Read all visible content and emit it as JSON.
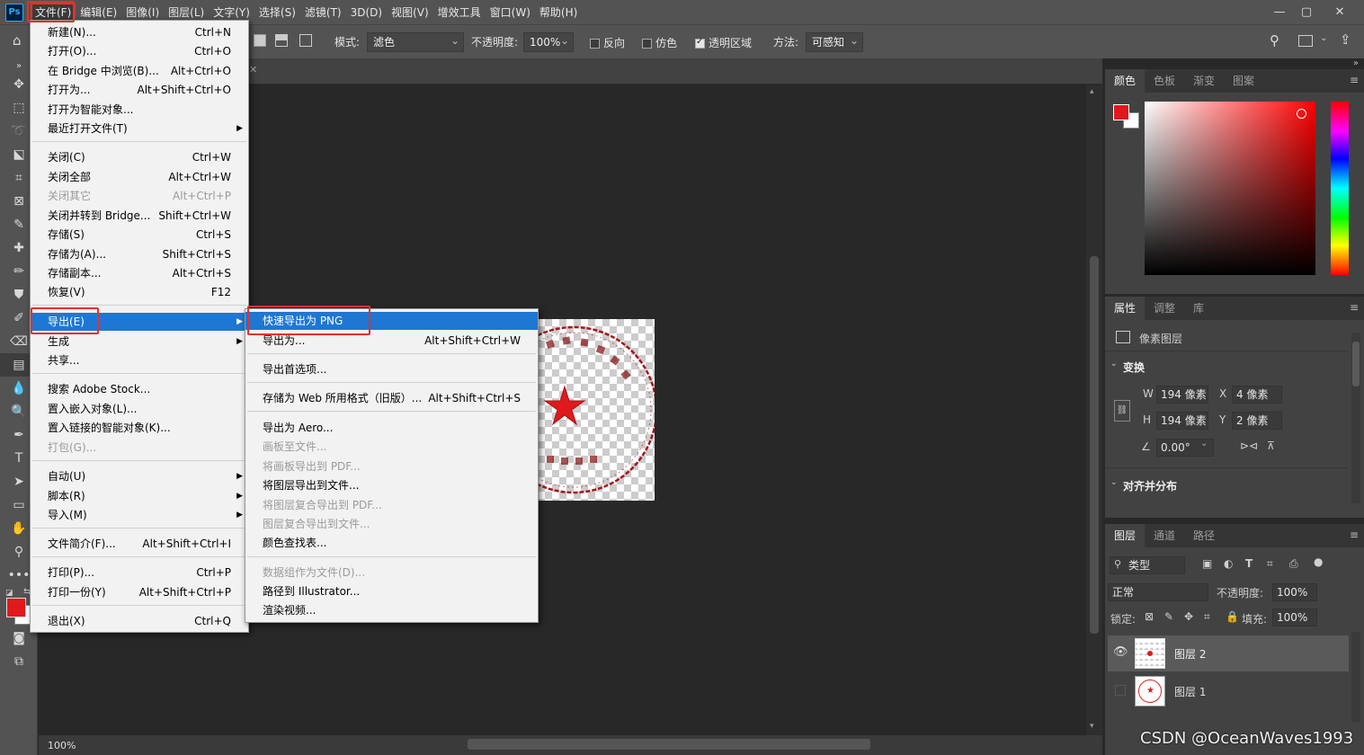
{
  "app": {
    "logo": "Ps"
  },
  "menubar": {
    "items": [
      "文件(F)",
      "编辑(E)",
      "图像(I)",
      "图层(L)",
      "文字(Y)",
      "选择(S)",
      "滤镜(T)",
      "3D(D)",
      "视图(V)",
      "增效工具",
      "窗口(W)",
      "帮助(H)"
    ]
  },
  "options": {
    "mode_label": "模式:",
    "mode_value": "滤色",
    "opacity_label": "不透明度:",
    "opacity_value": "100%",
    "reverse_label": "反向",
    "dither_label": "仿色",
    "transparency_label": "透明区域",
    "method_label": "方法:",
    "method_value": "可感知"
  },
  "file_menu": {
    "items": [
      {
        "label": "新建(N)...",
        "shortcut": "Ctrl+N"
      },
      {
        "label": "打开(O)...",
        "shortcut": "Ctrl+O"
      },
      {
        "label": "在 Bridge 中浏览(B)...",
        "shortcut": "Alt+Ctrl+O"
      },
      {
        "label": "打开为...",
        "shortcut": "Alt+Shift+Ctrl+O"
      },
      {
        "label": "打开为智能对象...",
        "shortcut": ""
      },
      {
        "label": "最近打开文件(T)",
        "shortcut": ""
      },
      {
        "label": "关闭(C)",
        "shortcut": "Ctrl+W"
      },
      {
        "label": "关闭全部",
        "shortcut": "Alt+Ctrl+W"
      },
      {
        "label": "关闭其它",
        "shortcut": "Alt+Ctrl+P"
      },
      {
        "label": "关闭并转到 Bridge...",
        "shortcut": "Shift+Ctrl+W"
      },
      {
        "label": "存储(S)",
        "shortcut": "Ctrl+S"
      },
      {
        "label": "存储为(A)...",
        "shortcut": "Shift+Ctrl+S"
      },
      {
        "label": "存储副本...",
        "shortcut": "Alt+Ctrl+S"
      },
      {
        "label": "恢复(V)",
        "shortcut": "F12"
      },
      {
        "label": "导出(E)",
        "shortcut": ""
      },
      {
        "label": "生成",
        "shortcut": ""
      },
      {
        "label": "共享...",
        "shortcut": ""
      },
      {
        "label": "搜索 Adobe Stock...",
        "shortcut": ""
      },
      {
        "label": "置入嵌入对象(L)...",
        "shortcut": ""
      },
      {
        "label": "置入链接的智能对象(K)...",
        "shortcut": ""
      },
      {
        "label": "打包(G)...",
        "shortcut": ""
      },
      {
        "label": "自动(U)",
        "shortcut": ""
      },
      {
        "label": "脚本(R)",
        "shortcut": ""
      },
      {
        "label": "导入(M)",
        "shortcut": ""
      },
      {
        "label": "文件简介(F)...",
        "shortcut": "Alt+Shift+Ctrl+I"
      },
      {
        "label": "打印(P)...",
        "shortcut": "Ctrl+P"
      },
      {
        "label": "打印一份(Y)",
        "shortcut": "Alt+Shift+Ctrl+P"
      },
      {
        "label": "退出(X)",
        "shortcut": "Ctrl+Q"
      }
    ]
  },
  "export_menu": {
    "items": [
      {
        "label": "快速导出为 PNG",
        "shortcut": ""
      },
      {
        "label": "导出为...",
        "shortcut": "Alt+Shift+Ctrl+W"
      },
      {
        "label": "导出首选项...",
        "shortcut": ""
      },
      {
        "label": "存储为 Web 所用格式（旧版）...",
        "shortcut": "Alt+Shift+Ctrl+S"
      },
      {
        "label": "导出为 Aero...",
        "shortcut": ""
      },
      {
        "label": "画板至文件...",
        "shortcut": ""
      },
      {
        "label": "将画板导出到 PDF...",
        "shortcut": ""
      },
      {
        "label": "将图层导出到文件...",
        "shortcut": ""
      },
      {
        "label": "将图层复合导出到 PDF...",
        "shortcut": ""
      },
      {
        "label": "图层复合导出到文件...",
        "shortcut": ""
      },
      {
        "label": "颜色查找表...",
        "shortcut": ""
      },
      {
        "label": "数据组作为文件(D)...",
        "shortcut": ""
      },
      {
        "label": "路径到 Illustrator...",
        "shortcut": ""
      },
      {
        "label": "渲染视频...",
        "shortcut": ""
      }
    ]
  },
  "color_panel": {
    "tabs": [
      "颜色",
      "色板",
      "渐变",
      "图案"
    ],
    "foreground": "#e0191d",
    "background": "#ffffff"
  },
  "properties_panel": {
    "tabs": [
      "属性",
      "调整",
      "库"
    ],
    "layer_type": "像素图层",
    "transform_label": "变换",
    "w_label": "W",
    "w_value": "194 像素",
    "h_label": "H",
    "h_value": "194 像素",
    "x_label": "X",
    "x_value": "4 像素",
    "y_label": "Y",
    "y_value": "2 像素",
    "angle_value": "0.00°",
    "align_label": "对齐并分布"
  },
  "layers_panel": {
    "tabs": [
      "图层",
      "通道",
      "路径"
    ],
    "filter_value": "类型",
    "blend_value": "正常",
    "opacity_label": "不透明度:",
    "opacity_value": "100%",
    "lock_label": "锁定:",
    "fill_label": "填充:",
    "fill_value": "100%",
    "layers": [
      {
        "name": "图层 2",
        "visible": true,
        "selected": true
      },
      {
        "name": "图层 1",
        "visible": false,
        "selected": false
      }
    ]
  },
  "status": {
    "zoom": "100%"
  },
  "watermark": "CSDN @OceanWaves1993"
}
